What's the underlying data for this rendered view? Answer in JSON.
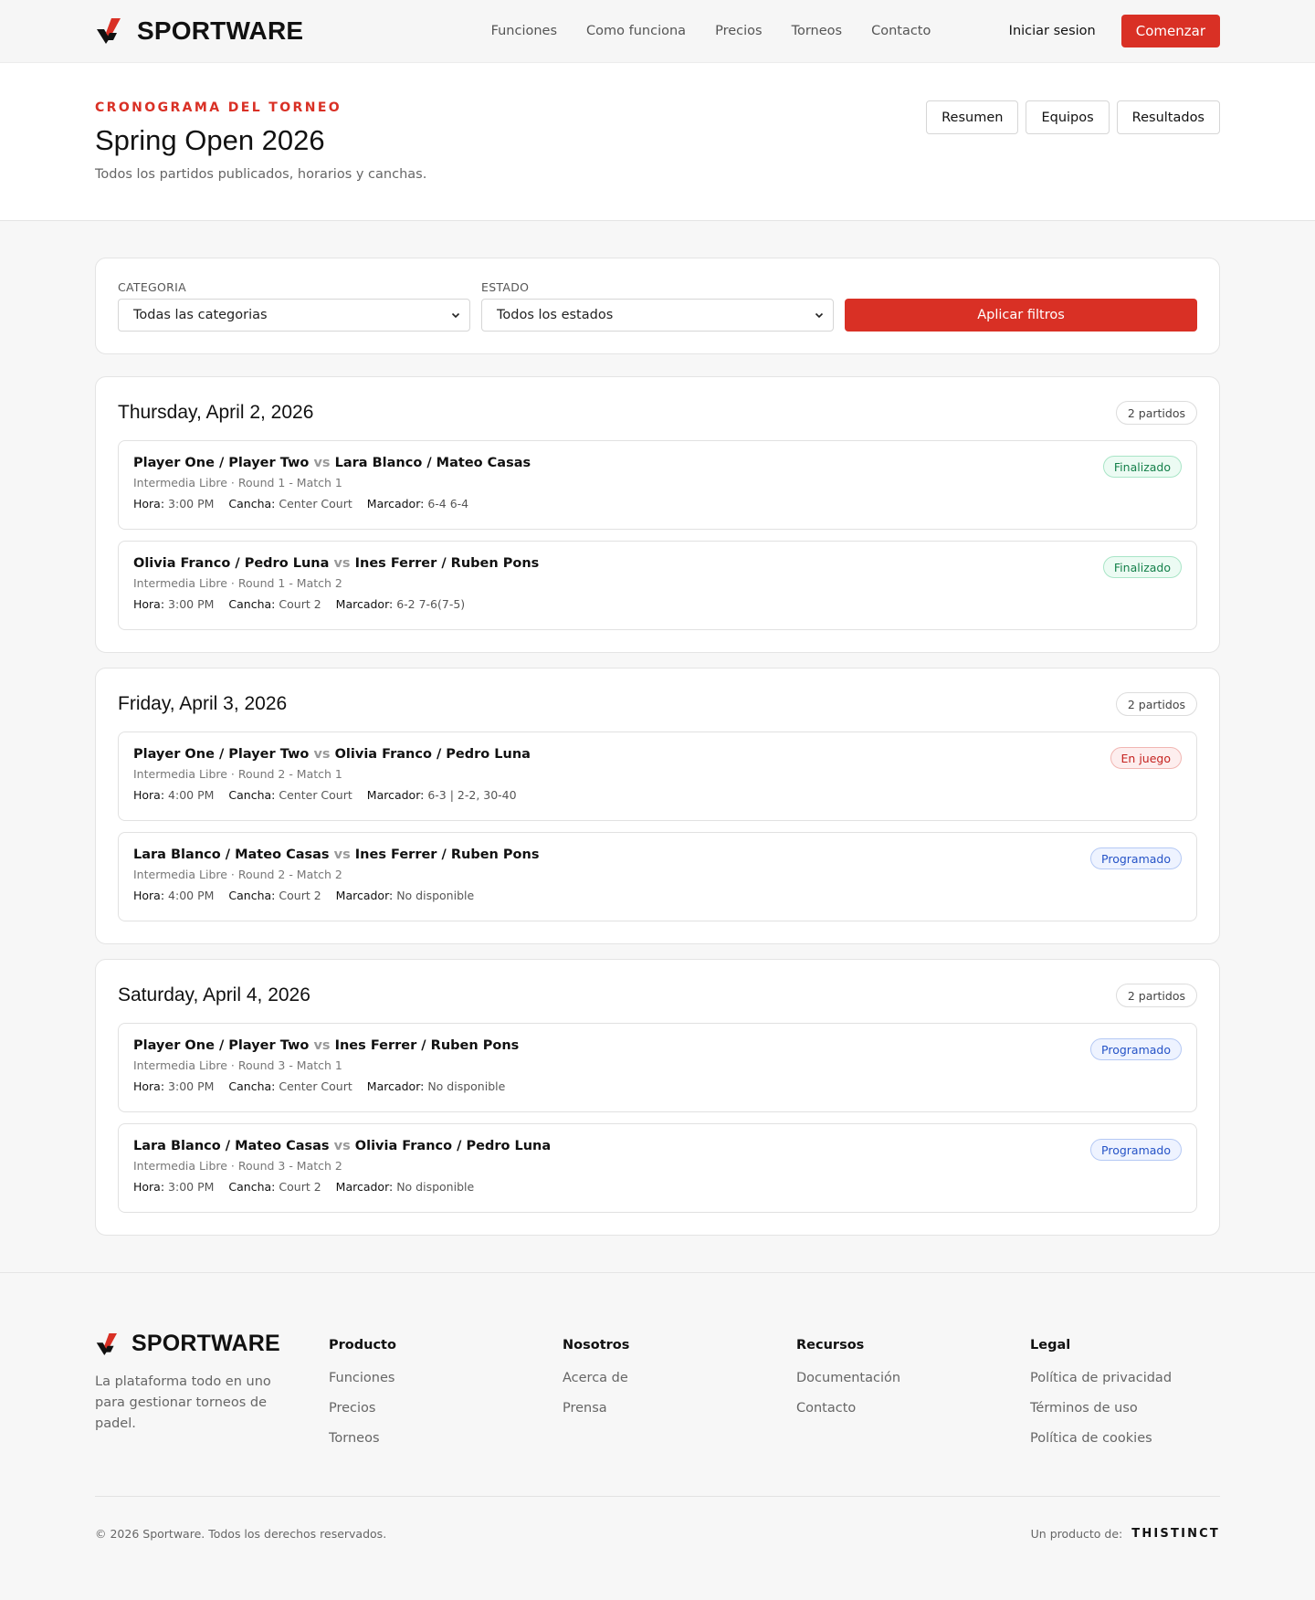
{
  "header": {
    "brand": "SPORTWARE",
    "nav": [
      "Funciones",
      "Como funciona",
      "Precios",
      "Torneos",
      "Contacto"
    ],
    "login_label": "Iniciar sesion",
    "cta_label": "Comenzar"
  },
  "hero": {
    "eyebrow": "CRONOGRAMA DEL TORNEO",
    "title": "Spring Open 2026",
    "subtitle": "Todos los partidos publicados, horarios y canchas.",
    "tabs": [
      "Resumen",
      "Equipos",
      "Resultados"
    ]
  },
  "filters": {
    "category_label": "CATEGORIA",
    "category_value": "Todas las categorias",
    "status_label": "ESTADO",
    "status_value": "Todos los estados",
    "apply_label": "Aplicar filtros"
  },
  "labels": {
    "vs": "vs",
    "time": "Hora:",
    "court": "Cancha:",
    "score": "Marcador:"
  },
  "days": [
    {
      "title": "Thursday, April 2, 2026",
      "count": "2 partidos",
      "matches": [
        {
          "team_a": "Player One / Player Two",
          "team_b": "Lara Blanco / Mateo Casas",
          "meta": "Intermedia Libre · Round 1 - Match 1",
          "time": "3:00 PM",
          "court": "Center Court",
          "score": "6-4 6-4",
          "status": "Finalizado",
          "status_type": "finished"
        },
        {
          "team_a": "Olivia Franco / Pedro Luna",
          "team_b": "Ines Ferrer / Ruben Pons",
          "meta": "Intermedia Libre · Round 1 - Match 2",
          "time": "3:00 PM",
          "court": "Court 2",
          "score": "6-2 7-6(7-5)",
          "status": "Finalizado",
          "status_type": "finished"
        }
      ]
    },
    {
      "title": "Friday, April 3, 2026",
      "count": "2 partidos",
      "matches": [
        {
          "team_a": "Player One / Player Two",
          "team_b": "Olivia Franco / Pedro Luna",
          "meta": "Intermedia Libre · Round 2 - Match 1",
          "time": "4:00 PM",
          "court": "Center Court",
          "score": "6-3 | 2-2, 30-40",
          "status": "En juego",
          "status_type": "live"
        },
        {
          "team_a": "Lara Blanco / Mateo Casas",
          "team_b": "Ines Ferrer / Ruben Pons",
          "meta": "Intermedia Libre · Round 2 - Match 2",
          "time": "4:00 PM",
          "court": "Court 2",
          "score": "No disponible",
          "status": "Programado",
          "status_type": "scheduled"
        }
      ]
    },
    {
      "title": "Saturday, April 4, 2026",
      "count": "2 partidos",
      "matches": [
        {
          "team_a": "Player One / Player Two",
          "team_b": "Ines Ferrer / Ruben Pons",
          "meta": "Intermedia Libre · Round 3 - Match 1",
          "time": "3:00 PM",
          "court": "Center Court",
          "score": "No disponible",
          "status": "Programado",
          "status_type": "scheduled"
        },
        {
          "team_a": "Lara Blanco / Mateo Casas",
          "team_b": "Olivia Franco / Pedro Luna",
          "meta": "Intermedia Libre · Round 3 - Match 2",
          "time": "3:00 PM",
          "court": "Court 2",
          "score": "No disponible",
          "status": "Programado",
          "status_type": "scheduled"
        }
      ]
    }
  ],
  "footer": {
    "brand": "SPORTWARE",
    "description": "La plataforma todo en uno para gestionar torneos de padel.",
    "columns": [
      {
        "title": "Producto",
        "links": [
          "Funciones",
          "Precios",
          "Torneos"
        ]
      },
      {
        "title": "Nosotros",
        "links": [
          "Acerca de",
          "Prensa"
        ]
      },
      {
        "title": "Recursos",
        "links": [
          "Documentación",
          "Contacto"
        ]
      },
      {
        "title": "Legal",
        "links": [
          "Política de privacidad",
          "Términos de uso",
          "Política de cookies"
        ]
      }
    ],
    "copyright": "© 2026 Sportware. Todos los derechos reservados.",
    "made_by_label": "Un producto de:",
    "made_by_brand": "THISTINCT"
  },
  "colors": {
    "accent": "#d93025",
    "finished": "#14804a",
    "live": "#c5221f",
    "scheduled": "#2553c7"
  }
}
